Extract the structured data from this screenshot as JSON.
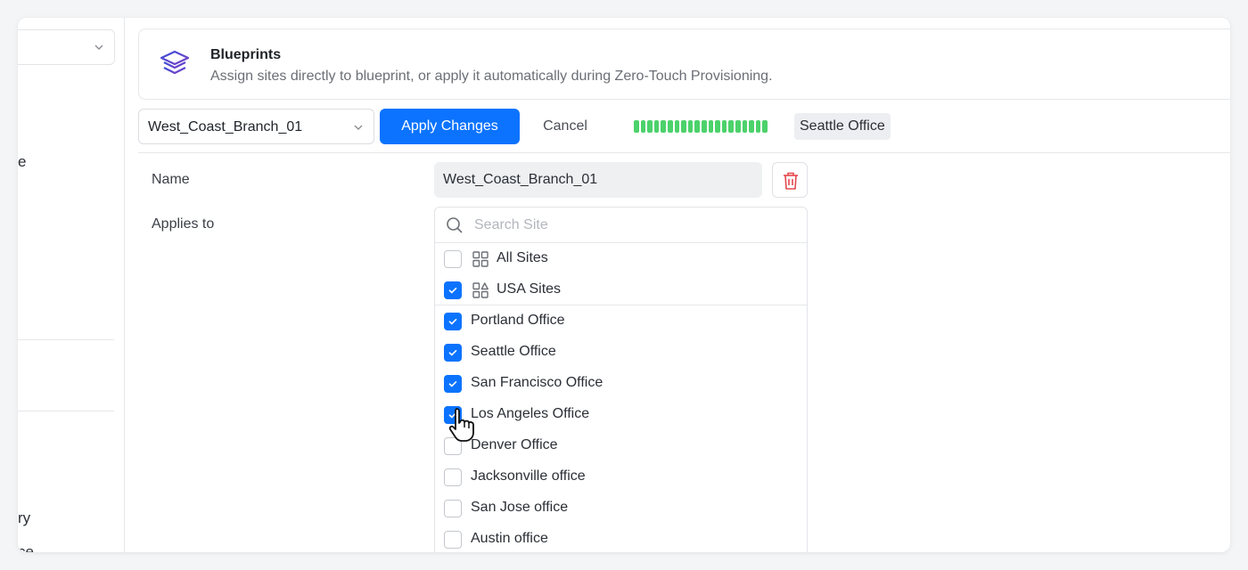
{
  "sidebar": {
    "fragments": [
      "e",
      "ry",
      "ce"
    ]
  },
  "header": {
    "title": "Blueprints",
    "subtitle": "Assign sites directly to blueprint, or apply it automatically during Zero-Touch Provisioning.",
    "icon": "layers-icon"
  },
  "toolbar": {
    "blueprint_selected": "West_Coast_Branch_01",
    "apply_label": "Apply Changes",
    "cancel_label": "Cancel",
    "progress_value": 1.0,
    "chip_label": "Seattle Office"
  },
  "form": {
    "name_label": "Name",
    "name_value": "West_Coast_Branch_01",
    "applies_label": "Applies to"
  },
  "site_picker": {
    "search_placeholder": "Search Site",
    "groups": [
      {
        "label": "All Sites",
        "checked": false,
        "icon": "grid-icon"
      },
      {
        "label": "USA Sites",
        "checked": true,
        "icon": "shapes-grid-icon"
      }
    ],
    "sites": [
      {
        "label": "Portland Office",
        "checked": true
      },
      {
        "label": "Seattle Office",
        "checked": true
      },
      {
        "label": "San Francisco Office",
        "checked": true
      },
      {
        "label": "Los Angeles Office",
        "checked": true
      },
      {
        "label": "Denver Office",
        "checked": false
      },
      {
        "label": "Jacksonville office",
        "checked": false
      },
      {
        "label": "San Jose office",
        "checked": false
      },
      {
        "label": "Austin office",
        "checked": false
      }
    ]
  },
  "colors": {
    "accent": "#0b73ff",
    "progress": "#4cd26b",
    "danger": "#e5484d"
  }
}
